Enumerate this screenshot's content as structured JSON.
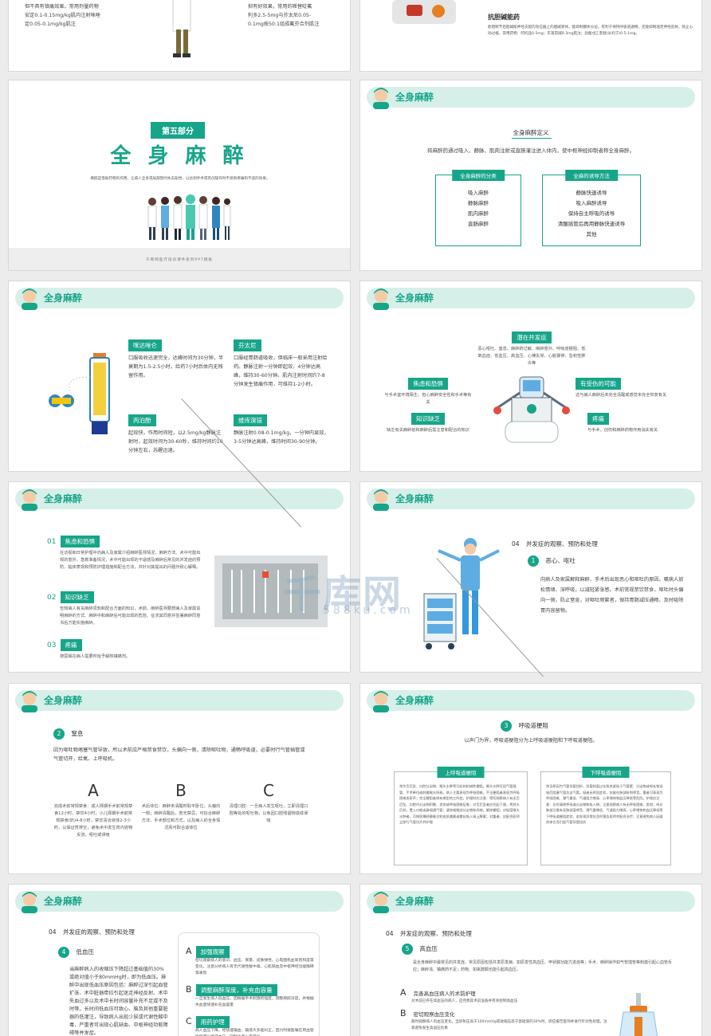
{
  "s1": {
    "left_l1": "但不具有镇痛效果。常用剂量药物",
    "left_l2": "安定0.1-0.15mg/kg肌内注射咪唑",
    "left_l3": "定0.05-0.1mg/kg肌注",
    "right_l1": "抑有好效果，常用的哌替啶氟",
    "right_l2": "利多2.5-5mg与芬太尼0.05-",
    "right_l3": "0.1mg按50:1组成氟芬合剂肌注"
  },
  "s2": {
    "heading": "抗胆碱能药",
    "body": "能阻断节后胆碱能神经支配的效应器上的胆碱受体。能抑制腺体分泌，有利于保持呼吸道通畅，还能抑制迷走神经反射，防止心动过缓。常用药物：阿托品0.5mg；东莨菪碱0.3mg肌注；盐酸戊乙奎醚(长托宁)0.5-1mg。"
  },
  "s3": {
    "badge": "第五部分",
    "title": "全 身 麻 醉",
    "desc": "麻醉是借助药物的作用，让病人全身或局部暂时失去知觉，以达到手术或有创操作时不感到疼痛和不适的效果。",
    "footer": "千库网医疗培训课件系列PPT模板"
  },
  "section_title": "全身麻醉",
  "s4": {
    "def_title": "全身麻醉定义",
    "def_body": "将麻醉药通过吸入、静脉、肌肉注射或直肠灌注进入体内，使中枢神经抑制者称全身麻醉。",
    "box1_title": "全身麻醉的分类",
    "box1_items": [
      "吸入麻醉",
      "静脉麻醉",
      "肌内麻醉",
      "直肠麻醉"
    ],
    "box2_title": "全麻的诱导方法",
    "box2_items": [
      "静脉快速诱导",
      "吸入麻醉诱导",
      "保持自主呼吸的诱导",
      "清醒插管后再用静脉快速诱导",
      "其他"
    ]
  },
  "s5": {
    "items": [
      {
        "title": "咪达唑仑",
        "body": "口服吸收迅速完全，达峰时间为30分钟，半衰期为1.5-2.5小时，给药7小时后体内无残留作用。"
      },
      {
        "title": "芬太尼",
        "body": "口服经胃肠道吸收，但临床一般采用注射给药。静脉注射一分钟即起效，4分钟达高峰，维持30-60分钟。肌内注射时间约7-8分钟发生镇痛作用，可维持1-2小时。"
      },
      {
        "title": "丙泊酚",
        "body": "起效快，作用时间短，以2.5mg/kg静脉注射时，起效时间为30-60秒，维持时间约10分钟左右，苏醒迅速。"
      },
      {
        "title": "维库溴铵",
        "body": "静脉注射0.08-0.1mg/kg，一分钟内显效，3-5分钟达高峰，维持时间30-90分钟。"
      }
    ]
  },
  "s6": {
    "center_title": "潜在并发症",
    "center_body": "恶心呕吐、窒息、麻醉药过敏、麻醉意外、呼吸道梗阻、低氧血症、低血压、高血压、心律失常、心脏骤停、坠积性肺炎等",
    "left1_title": "焦虑和恐惧",
    "left1_body": "与手术室环境陌生、担心麻醉安全性和手术等有关",
    "left2_title": "知识缺乏",
    "left2_body": "缺乏有关麻醉前和麻醉后需注意和配合的知识",
    "right1_title": "有受伤的可能",
    "right1_body": "这与病人麻醉后未完全清醒或感觉未完全恢复有关",
    "right2_title": "疼痛",
    "right2_body": "与手术、创伤和麻醉药物作用消失有关"
  },
  "s7": {
    "items": [
      {
        "num": "01",
        "title": "焦虑和恐惧",
        "body": "在访视和日常护理中向病人及家属介绍麻醉医师情况、麻醉方法、术中可能出现的意外、急救准备情况，术中可能出现的不适感及麻醉后常见的并发症的预防、临床表现和预防护理措施和配合方法，并针对其提出的问题作耐心解释。"
      },
      {
        "num": "02",
        "title": "知识缺乏",
        "body": "告知病人有关麻醉须知和配合方面的知识，术前、麻醉医师要想病人及家属说明麻醉的方式、麻醉中和麻醉后可能出现的危险、征求其同意并签署麻醉同意书后方能实施麻醉。"
      },
      {
        "num": "03",
        "title": "疼痛",
        "body": "按医嘱在病人需要时给予解热镇痛剂。"
      }
    ]
  },
  "s8": {
    "head_num": "04",
    "head": "并发症的观察、预防和处理",
    "sub_num": "1",
    "sub": "恶心、呕吐",
    "body": "向病人及家属解释麻醉、手术后出现恶心和呕吐的原因。嘱病人放松情绪、深呼吸，以减轻紧张感。术前常规禁饮禁食，呕吐时头偏向一侧，防止窒息，对呕吐频繁者，保持胃肠减压通畅、及时吸除胃内容留物。"
  },
  "s9": {
    "sub_num": "2",
    "sub": "窒息",
    "intro": "因为呕吐物堵塞气管导致，所以术前应严格禁食禁饮，头偏向一侧，清除呕吐物，通畅呼吸道，必要时行气管插管或气管切开，给氧、上呼吸机。",
    "cols": [
      {
        "letter": "A",
        "body": "完成术前常规禁食：成人择期手术前常规禁食12小时、禁饮4小时；小儿择期手术前常规禁食(奶)4-8小时，禁饮清淡液体2-3小时，以保证胃排空，避免术中发生胃内容物反流、呕吐或误吸"
      },
      {
        "letter": "B",
        "body": "术后体位：麻醉未清醒时取平卧位，头偏向一侧；麻醉清醒后，若无禁忌，可抬合麻醉方法、手术部位和方式，以及病人的全身情况而可取合适体位"
      },
      {
        "letter": "C",
        "body": "清理口腔：一旦病人发生呕吐，立即清理口腔等处的呕吐物，以免因口腔残留物造成误吸"
      }
    ]
  },
  "s10": {
    "sub_num": "3",
    "sub": "呼吸道梗阻",
    "intro": "以声门为界，呼吸道梗阻分为上呼吸道梗阻和下呼吸道梗阻。",
    "box1_title": "上呼吸道梗阻",
    "box1_body": "常为舌后坠、口腔分泌物、喉头水肿等引起的机械性梗阻。喉头水肿可因气管插管、手术牵拉或刺激喉头所致。病人主要表现为呼吸困难。不全梗阻者表现为呼吸困难发鼾声；完全梗阻者则有典型的三凹症。护理时应注意：密切观察病人有无舌后坠、口腔内分泌物积聚、发绀或呼吸困难征象；对舌后坠者应托起下颌，将其头后仰，置入口咽或鼻咽通气管；清除咽喉部分泌物和异物，解除梗阻；对轻度喉头水肿者，可按医嘱经静脉注射皮质激素或雾化吸入肾上腺素；对重者，应配合医师立即行气管切开并护理",
    "box2_title": "下呼吸道梗阻",
    "box2_body": "常见原因为气管导管扭折、导管斜面过长致其紧贴于气管壁、分泌物或呕吐物误吸后阻塞气管及支气管。轻者无明显症状，仅能在肺部听到啰音。重者可表现为呼吸困难、潮气量低、气道阻力增高、心率增快和血压降低等危险。护理应注意：及时清除呼吸道分泌物和吸入物；注意观察病人有无呼吸困难、发绀；听诊肺部注意有无肺部湿啰音、潮气量降低、气道阻力增高、心率增快和血压降低等下呼吸道梗阻症状，若发现异常应及时报告医师并配合治疗；注意避免病人因姿势体位而引起气管导管扭折"
  },
  "s11": {
    "head_num": "04",
    "head": "并发症的观察、预防和处理",
    "sub_num": "4",
    "sub": "低血压",
    "body": "当麻醉病人的收缩压下降超过基础值的30%或绝对值小于80mmHg时，即为低血压。麻醉中出现低血压原因包括：麻醉过深引起血管扩张、术中脏器牵拉引起迷走神经反射、术中失血过多以及术中长时间容量补充不足或不及时等。长时间低血压可致心、脑及其他重要脏器的低灌注，导致病人出现少尿或代谢性酸中毒，严重者可出现心肌缺血、中枢神经功能障碍等并发症。",
    "items": [
      {
        "letter": "A",
        "title": "加强观察",
        "body": "密切观察病人的意识、血压、尿量、皮肤弹性、心电图机血氧饱和度等变化。注意分析病人有无代谢性酸中毒、心肌缺血及中枢神经功能障碍等表现"
      },
      {
        "letter": "B",
        "title": "调整麻醉深度，补充血容量",
        "body": "一旦发生病人低血压，因根据手术刺激的强度，调整麻醉深度，并根据失血量快速补充血容量"
      },
      {
        "letter": "C",
        "title": "用药护理",
        "body": "病人血压下降，经快速输血、输液大多能纠正，因力时按医嘱在用血管收缩药以维持血压，同时注意心率变化"
      }
    ]
  },
  "s12": {
    "head_num": "04",
    "head": "并发症的观察、预防和处理",
    "sub_num": "5",
    "sub": "高血压",
    "body": "是全身麻醉中最常见的并发症。常见原因包括并发原发病、如原发性高血压、甲状腺功能亢进症等；手术、麻醉操作如气管插管等刺激引起心血管反应；麻醉浅、镇痛药不足；药物、如氯胺酮也能引起高血压。",
    "items": [
      {
        "letter": "A",
        "title": "完善高血压病人的术前护理",
        "body": "对术前已存在高血压的病人，应完善其术前准备并有效控制高血压"
      },
      {
        "letter": "B",
        "title": "密切观察血压变化",
        "body": "随时观察病人的血压变化，当舒张压高于100mmHg或收缩压高于基础值的30%时，即应报告医师并进行针对性处理，注意避免发生高血压危象"
      }
    ]
  },
  "watermark": "千库网",
  "watermark_url": "588ku.com"
}
